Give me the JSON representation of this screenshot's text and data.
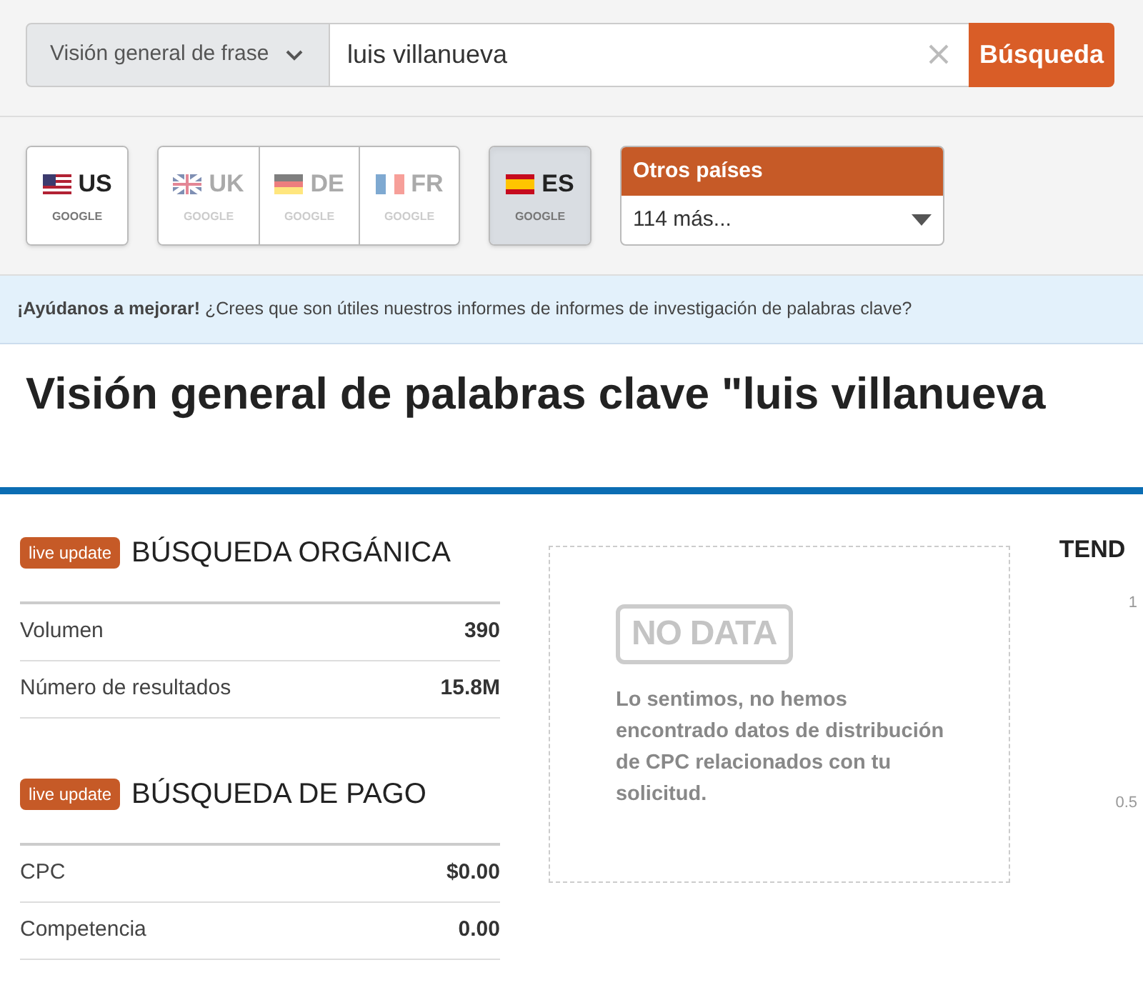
{
  "search": {
    "mode": "Visión general de frase",
    "query": "luis villanueva",
    "button": "Búsqueda"
  },
  "database_groups": [
    {
      "databases": [
        {
          "code": "US",
          "engine": "GOOGLE",
          "kind": "us",
          "selected": false,
          "disabled": false
        }
      ]
    },
    {
      "databases": [
        {
          "code": "UK",
          "engine": "GOOGLE",
          "kind": "uk",
          "selected": false,
          "disabled": true
        },
        {
          "code": "DE",
          "engine": "GOOGLE",
          "kind": "de",
          "selected": false,
          "disabled": true
        },
        {
          "code": "FR",
          "engine": "GOOGLE",
          "kind": "fr",
          "selected": false,
          "disabled": true
        }
      ]
    },
    {
      "databases": [
        {
          "code": "ES",
          "engine": "GOOGLE",
          "kind": "es",
          "selected": true,
          "disabled": false
        }
      ]
    }
  ],
  "other_countries": {
    "title": "Otros países",
    "value": "114 más..."
  },
  "feedback_banner": "**¡Ayúdanos a mejorar!** ¿Crees que son útiles nuestros informes de informes de investigación de palabras clave?",
  "page_title": "Visión general de palabras clave \"luis villanueva",
  "sections": [
    {
      "badge": "live update",
      "title": "BÚSQUEDA ORGÁNICA",
      "rows": [
        {
          "label": "Volumen",
          "value": "390"
        },
        {
          "label": "Número de resultados",
          "value": "15.8M"
        }
      ]
    },
    {
      "badge": "live update",
      "title": "BÚSQUEDA DE PAGO",
      "rows": [
        {
          "label": "CPC",
          "value": "$0.00"
        },
        {
          "label": "Competencia",
          "value": "0.00"
        }
      ]
    }
  ],
  "cpc_distribution": {
    "stamp": "NO DATA",
    "message": "Lo sentimos, no hemos encontrado datos de distribución de CPC relacionados con tu solicitud."
  },
  "trend": {
    "title": "TEND",
    "axis_labels": [
      "1",
      "0.5"
    ]
  }
}
